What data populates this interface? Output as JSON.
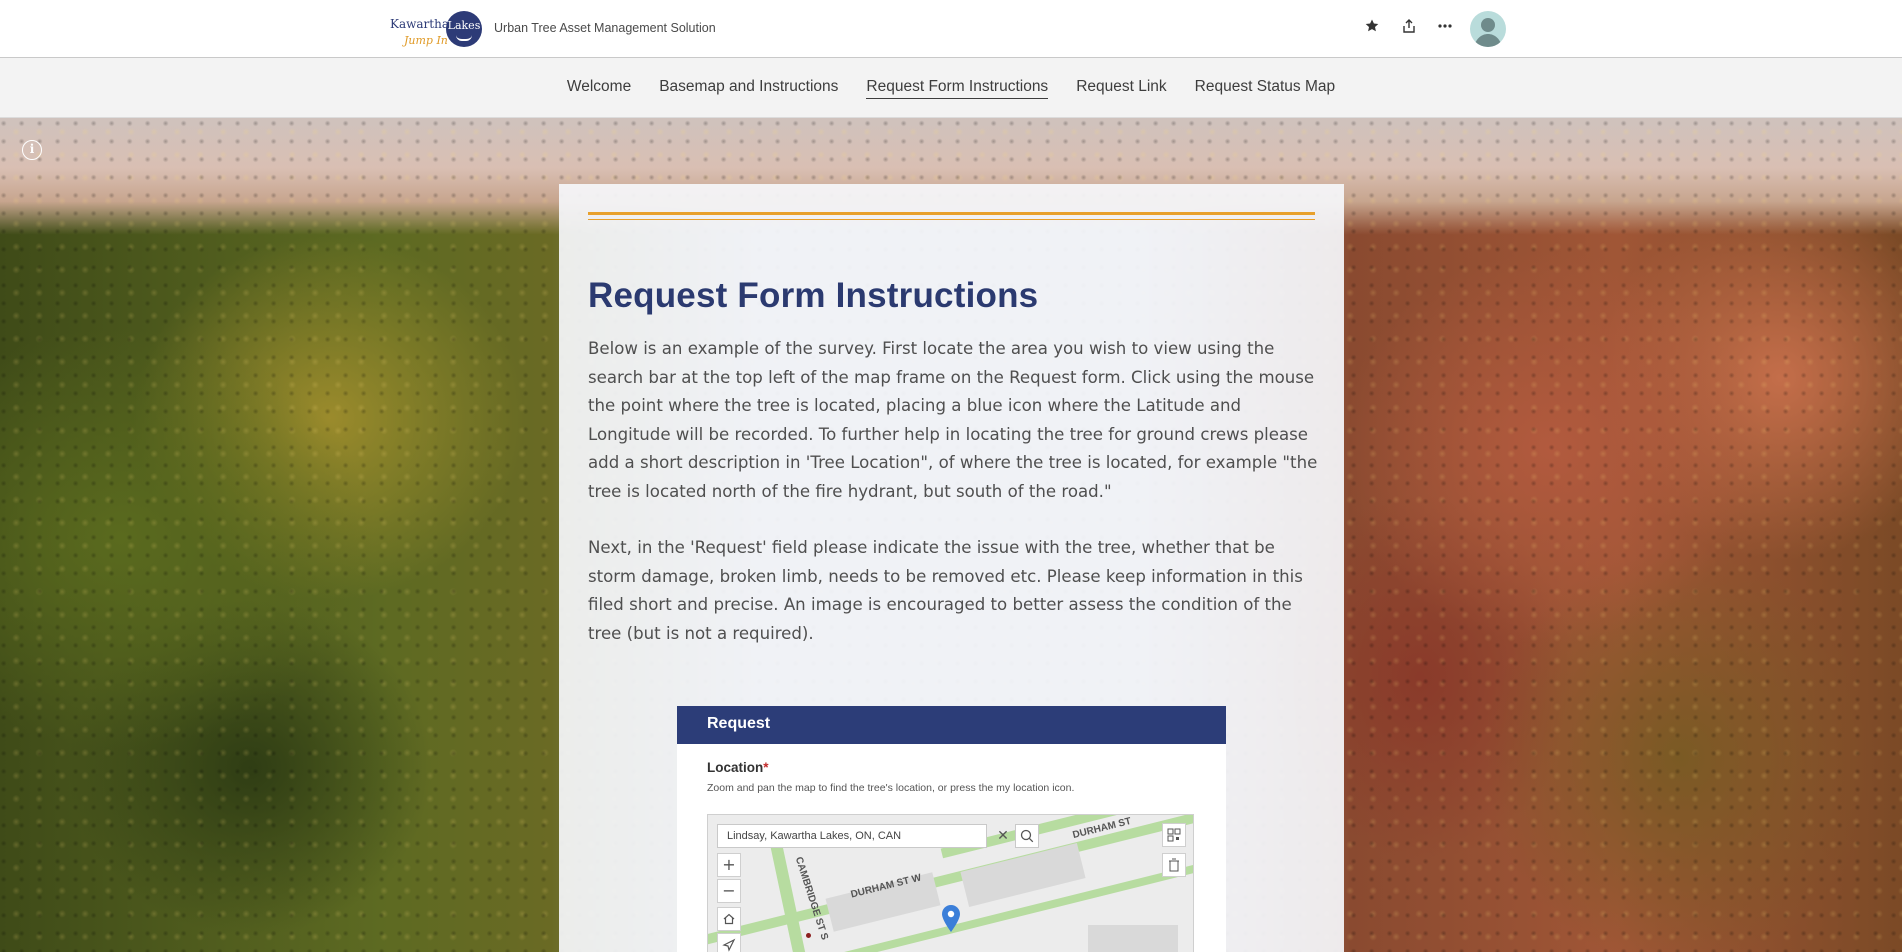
{
  "header": {
    "logo": {
      "line1": "Kawartha",
      "line2": "Jump In",
      "badge": "Lakes"
    },
    "site_title": "Urban Tree Asset Management Solution",
    "icons": [
      "star-icon",
      "share-icon",
      "more-icon",
      "user-avatar"
    ]
  },
  "nav": {
    "items": [
      {
        "label": "Welcome"
      },
      {
        "label": "Basemap and Instructions"
      },
      {
        "label": "Request Form Instructions",
        "active": true
      },
      {
        "label": "Request Link"
      },
      {
        "label": "Request Status Map"
      }
    ]
  },
  "content": {
    "title": "Request Form Instructions",
    "paragraph1": "Below is an example of the survey. First locate the area you wish to view using the search bar at the top left of the map frame on the Request form. Click using the mouse the point where the tree is located, placing a blue icon where the Latitude and Longitude will be recorded. To further help in locating the tree for ground crews please add a short description in 'Tree Location\", of where the tree is located, for example \"the tree is located north of the fire hydrant, but south of the road.\"",
    "paragraph2": "Next, in the 'Request' field please indicate the issue with the tree, whether that be storm damage, broken limb, needs to be removed etc. Please keep information in this filed short and precise. An image is encouraged to better assess the condition of the tree (but is not a required).",
    "accent_color": "#e8a02c",
    "title_color": "#2b3a70"
  },
  "form_example": {
    "header": "Request",
    "field_label": "Location",
    "required_mark": "*",
    "help_text": "Zoom and pan the map to find the tree's location, or press the my location icon.",
    "search_value": "Lindsay, Kawartha Lakes, ON, CAN",
    "street_labels": {
      "durham_top": "DURHAM ST",
      "durham_mid": "DURHAM ST W",
      "cambridge": "CAMBRIDGE ST S"
    },
    "header_color": "#2c3d78",
    "pin_color": "#3b7fd9"
  }
}
